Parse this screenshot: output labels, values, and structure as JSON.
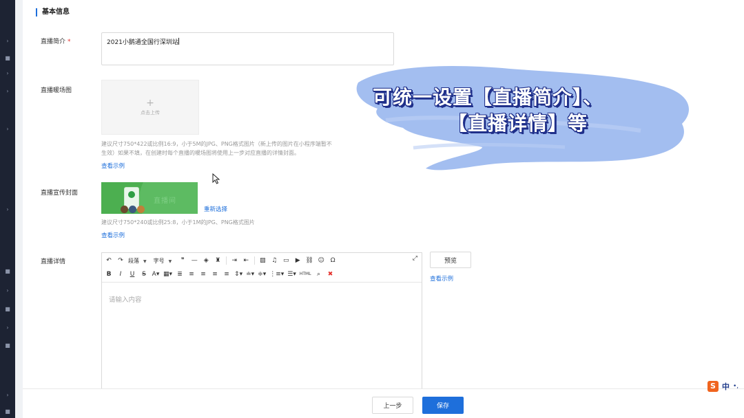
{
  "section": {
    "title": "基本信息"
  },
  "intro": {
    "label": "直播简介",
    "required_mark": "*",
    "value": "2021小鹅通全国行深圳站"
  },
  "warmup": {
    "label": "直播暖场图",
    "upload_icon": "+",
    "upload_text": "点击上传",
    "hint_line1": "建议尺寸750*422或比例16:9，小于5M的JPG、PNG格式图片（新上传的图片在小程序端暂不",
    "hint_line2": "生效）如果不填，在创建时每个直播的暖场图将使用上一步对应直播的详情封面。",
    "example_link": "查看示例"
  },
  "cover": {
    "label": "直播宣传封面",
    "image_text": "直播间",
    "reselect_link": "重新选择",
    "hint": "建议尺寸750*240或比例25:8，小于1M的JPG、PNG格式图片",
    "example_link": "查看示例"
  },
  "detail": {
    "label": "直播详情",
    "toolbar": {
      "paragraph": "段落",
      "font_size": "字号",
      "html_label": "HTML"
    },
    "placeholder": "请输入内容",
    "preview_button": "预览",
    "example_link": "查看示例"
  },
  "footer": {
    "prev_button": "上一步",
    "save_button": "保存"
  },
  "overlay": {
    "line1": "可统一设置【直播简介】、",
    "line2": "【直播详情】等",
    "brush_color": "#9bb8ef",
    "outline_color": "#1f2f8a"
  },
  "ime": {
    "logo": "S",
    "lang": "中",
    "extra": "•,"
  },
  "colors": {
    "primary": "#1e6fdb",
    "sidebar": "#1d2333",
    "required": "#e5322d"
  }
}
